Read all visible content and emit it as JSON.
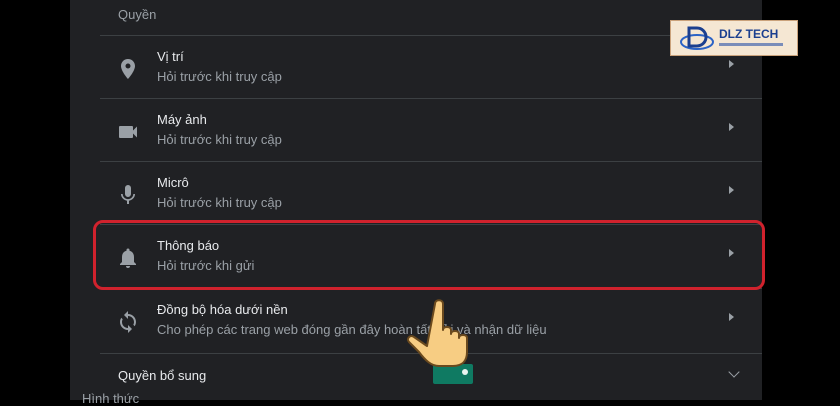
{
  "section": {
    "title": "Quyền"
  },
  "permissions": [
    {
      "title": "Vị trí",
      "sub": "Hỏi trước khi truy cập",
      "icon": "location-icon"
    },
    {
      "title": "Máy ảnh",
      "sub": "Hỏi trước khi truy cập",
      "icon": "camera-icon"
    },
    {
      "title": "Micrô",
      "sub": "Hỏi trước khi truy cập",
      "icon": "microphone-icon"
    },
    {
      "title": "Thông báo",
      "sub": "Hỏi trước khi gửi",
      "icon": "bell-icon"
    },
    {
      "title": "Đồng bộ hóa dưới nền",
      "sub": "Cho phép các trang web đóng gần đây hoàn tất gửi và nhận dữ liệu",
      "icon": "sync-icon"
    }
  ],
  "extra": {
    "label": "Quyền bổ sung"
  },
  "below_text": "Hình thức",
  "logo": {
    "brand": "DLZ TECH"
  },
  "colors": {
    "highlight": "#d0222d",
    "panel": "#202124"
  }
}
